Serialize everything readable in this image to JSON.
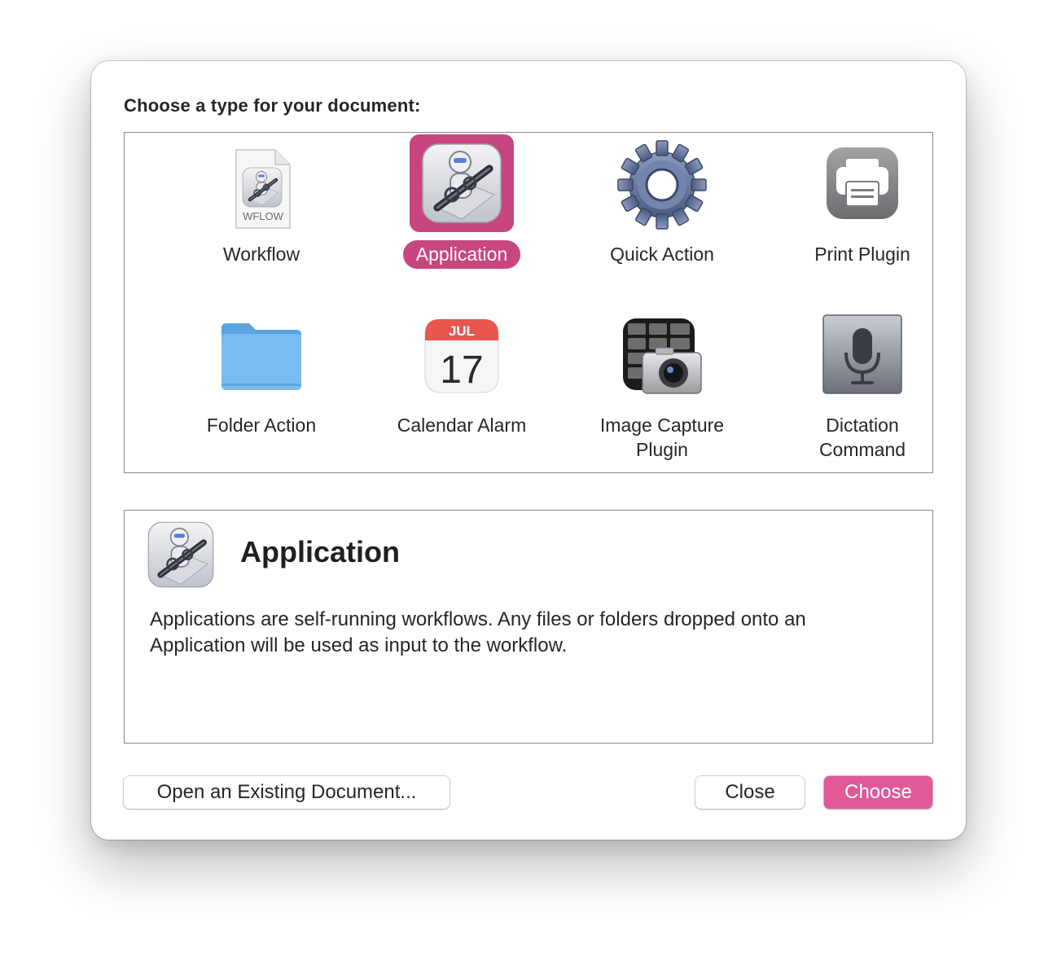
{
  "dialog": {
    "heading": "Choose a type for your document:"
  },
  "types": [
    {
      "label": "Workflow",
      "icon": "workflow-file-icon",
      "badge": "WFLOW",
      "selected": false
    },
    {
      "label": "Application",
      "icon": "automator-robot-icon",
      "selected": true
    },
    {
      "label": "Quick Action",
      "icon": "gear-icon",
      "selected": false
    },
    {
      "label": "Print Plugin",
      "icon": "printer-icon",
      "selected": false
    },
    {
      "label": "Folder Action",
      "icon": "folder-icon",
      "selected": false
    },
    {
      "label": "Calendar Alarm",
      "icon": "calendar-icon",
      "month": "JUL",
      "day": "17",
      "selected": false
    },
    {
      "label_line1": "Image Capture",
      "label_line2": "Plugin",
      "icon": "image-capture-icon",
      "selected": false
    },
    {
      "label_line1": "Dictation",
      "label_line2": "Command",
      "icon": "microphone-icon",
      "selected": false
    }
  ],
  "description": {
    "title": "Application",
    "icon": "automator-robot-icon",
    "text": "Applications are self-running workflows. Any files or folders dropped onto an Application will be used as input to the workflow."
  },
  "buttons": {
    "open_existing": "Open an Existing Document...",
    "close": "Close",
    "choose": "Choose"
  },
  "colors": {
    "accent": "#c8467f",
    "primary_button": "#e05a98",
    "folder_blue": "#6fb5ec"
  }
}
